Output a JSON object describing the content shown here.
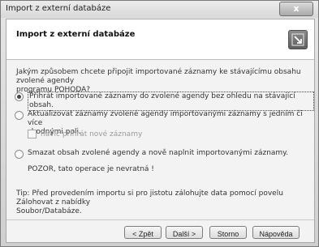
{
  "window": {
    "title": "Import z externí databáze",
    "close_label": "x"
  },
  "header": {
    "title": "Import z externí databáze",
    "icon": "import-arrow-icon"
  },
  "question": {
    "line1": "Jakým způsobem chcete připojit importované záznamy ke stávajícímu obsahu zvolené agendy",
    "line2": "programu POHODA?"
  },
  "options": [
    {
      "label": "Přihrát importované záznamy do zvolené agendy bez ohledu na stávající obsah.",
      "selected": true
    },
    {
      "label_line1": "Aktualizovat záznamy zvolené agendy importovanými záznamy s jedním či více",
      "label_line2": "shodnými poli.",
      "selected": false
    },
    {
      "label": "Smazat obsah zvolené agendy a nově naplnit importovanými záznamy.",
      "selected": false
    }
  ],
  "checkbox": {
    "label": "navíc přihrát nové záznamy",
    "checked": false,
    "disabled": true
  },
  "warning": "POZOR, tato operace je nevratná !",
  "tip": {
    "line1": "Tip: Před provedením importu si pro jistotu zálohujte data pomocí povelu Zálohovat z nabídky",
    "line2": "Soubor/Databáze."
  },
  "buttons": {
    "back": "< Zpět",
    "next": "Další >",
    "cancel": "Storno",
    "help": "Nápověda"
  }
}
